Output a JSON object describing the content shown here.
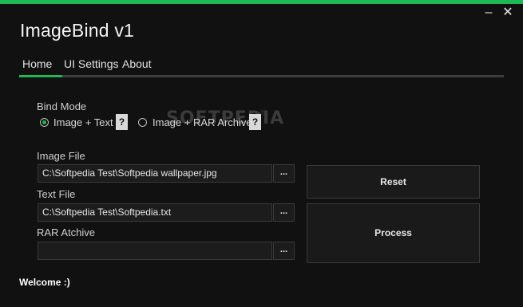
{
  "window": {
    "title": "ImageBind v1",
    "minimize_glyph": "–",
    "close_glyph": "✕",
    "accent_color": "#1db954"
  },
  "tabs": [
    {
      "label": "Home",
      "active": true
    },
    {
      "label": "UI Settings",
      "active": false
    },
    {
      "label": "About",
      "active": false
    }
  ],
  "bind_mode": {
    "label": "Bind Mode",
    "options": [
      {
        "label": "Image + Text",
        "checked": true,
        "help": "?"
      },
      {
        "label": "Image + RAR Archive",
        "checked": false,
        "help": "?"
      }
    ]
  },
  "watermark": {
    "text": "SOFTPEDIA",
    "mark": "®"
  },
  "fields": {
    "image": {
      "label": "Image File",
      "value": "C:\\Softpedia Test\\Softpedia wallpaper.jpg",
      "browse": "..."
    },
    "text": {
      "label": "Text File",
      "value": "C:\\Softpedia Test\\Softpedia.txt",
      "browse": "..."
    },
    "rar": {
      "label": "RAR Atchive",
      "value": "",
      "browse": "..."
    }
  },
  "buttons": {
    "reset": "Reset",
    "process": "Process"
  },
  "status": "Welcome :)"
}
